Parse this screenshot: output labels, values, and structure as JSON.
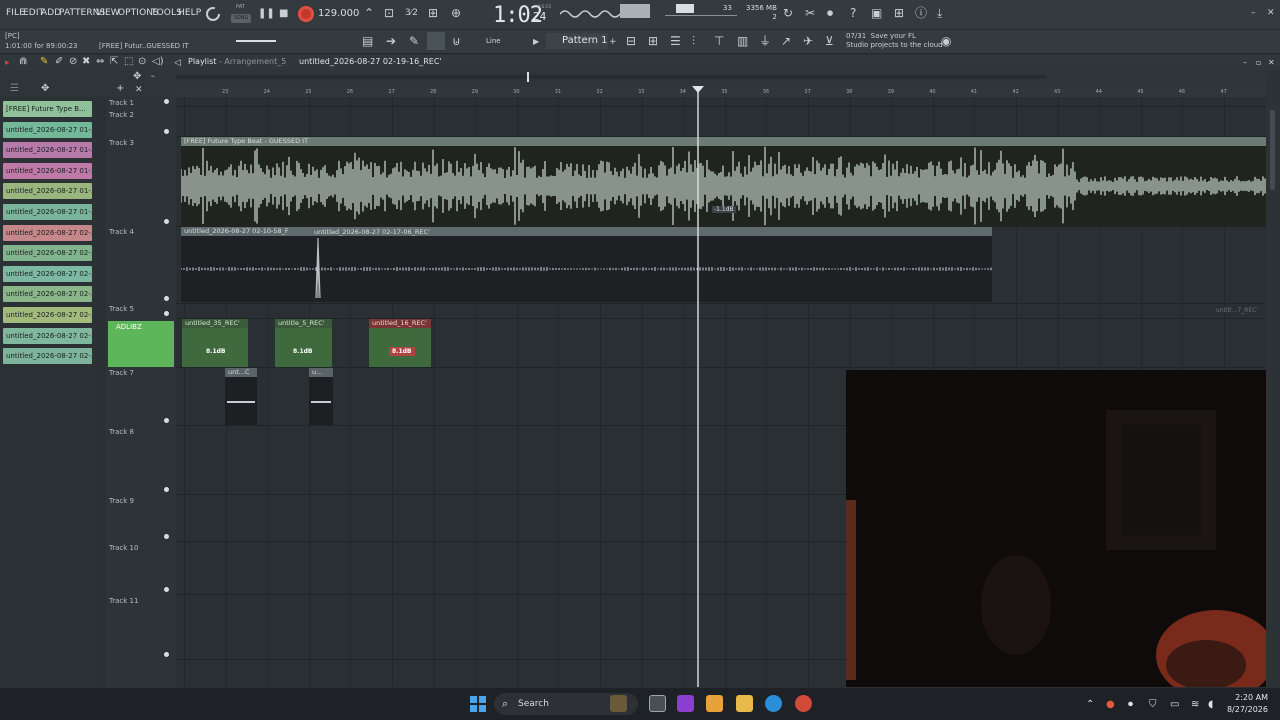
{
  "menu": [
    "FILE",
    "EDIT",
    "ADD",
    "PATTERNS",
    "VIEW",
    "OPTIONS",
    "TOOLS",
    "HELP"
  ],
  "transport": {
    "tempo": "129.000",
    "time": "1:02",
    "time_small": "24",
    "time_unit": "M:S:CS",
    "pat_song": "PAT",
    "song_label": "SONG",
    "memory": "3356 MB",
    "memory_sub": "2",
    "cpu": "33"
  },
  "hints": {
    "pc": "[PC]",
    "position": "1:01:00 for 89:00:23",
    "hover": "[FREE] Futur..GUESSED IT"
  },
  "toolbar2": {
    "snap": "Line",
    "pattern": "Pattern 1",
    "news_date": "07/31",
    "news_line1": "Save your FL",
    "news_line2": "Studio projects to the cloud"
  },
  "playlist": {
    "title": "Playlist",
    "arrangement": "Arrangement_5",
    "path": "untitled_2026-08-27 02-19-16_REC'",
    "bars": [
      "23",
      "24",
      "25",
      "26",
      "27",
      "28",
      "29",
      "30",
      "31",
      "32",
      "33",
      "34",
      "35",
      "36",
      "37",
      "38",
      "39",
      "40",
      "41",
      "42",
      "43",
      "44",
      "45",
      "46",
      "47"
    ],
    "tracks": [
      "Track 1",
      "Track 2",
      "Track 3",
      "Track 4",
      "Track 5",
      "ADLIBZ",
      "Track 7",
      "Track 8",
      "Track 9",
      "Track 10",
      "Track 11"
    ]
  },
  "picker": [
    {
      "label": "[FREE] Future Type B...",
      "color": "#8fc09a"
    },
    {
      "label": "untitled_2026-08-27 01-...",
      "color": "#74b89a"
    },
    {
      "label": "untitled_2026-08-27 01-...",
      "color": "#b77aab"
    },
    {
      "label": "untitled_2026-08-27 01-...",
      "color": "#c07aa8"
    },
    {
      "label": "untitled_2026-08-27 01-...",
      "color": "#9ab67e"
    },
    {
      "label": "untitled_2026-08-27 01-...",
      "color": "#7ab59b"
    },
    {
      "label": "untitled_2026-08-27 02-...",
      "color": "#c5878a"
    },
    {
      "label": "untitled_2026-08-27 02-...",
      "color": "#82b58d"
    },
    {
      "label": "untitled_2026-08-27 02-...",
      "color": "#7cb8a2"
    },
    {
      "label": "untitled_2026-08-27 02-...",
      "color": "#8ab68a"
    },
    {
      "label": "untitled_2026-08-27 02-...",
      "color": "#a2bb7d"
    },
    {
      "label": "untitled_2026-08-27 02-...",
      "color": "#7fb89d"
    },
    {
      "label": "untitled_2026-08-27 02-...",
      "color": "#7eb49c"
    }
  ],
  "clips": {
    "beat": "[FREE] Future Type Beat - GUESSED IT",
    "beat_db": "-1.1dB",
    "vocal_a": "untitled_2026-08-27 02-10-58_F",
    "vocal_b": "untitled_2026-08-27 02-17-06_REC'",
    "ad1": "untitled_35_REC'",
    "ad1_db": "8.1dB",
    "ad2": "untitle_5_REC'",
    "ad2_db": "8.1dB",
    "ad3": "untitled_16_REC'",
    "ad3_db": "8.1dB",
    "t7a": "unt...C",
    "t7b": "u...",
    "faint": "untitl...7_REC'"
  },
  "taskbar": {
    "search": "Search",
    "time": "2:20 AM",
    "date": "8/27/2026"
  },
  "colors": {
    "record": "#c0392b",
    "adlibz_header": "#5db65a",
    "beat_clip": "#6f7d76",
    "red_clip": "#b2433f"
  }
}
